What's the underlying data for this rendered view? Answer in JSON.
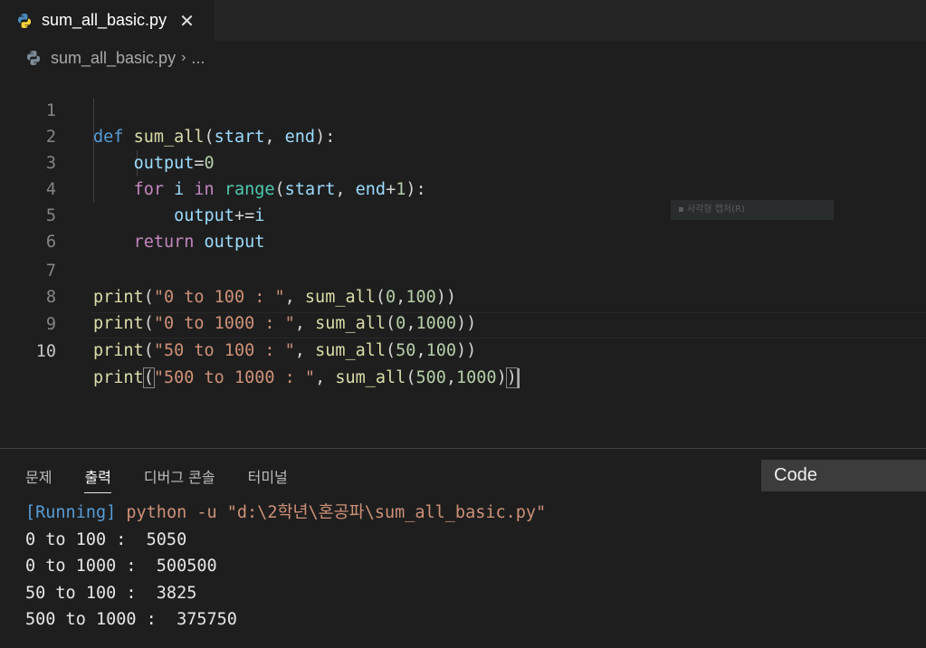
{
  "tab": {
    "file_name": "sum_all_basic.py",
    "close_glyph": "✕"
  },
  "breadcrumb": {
    "file_name": "sum_all_basic.py",
    "separator": "›",
    "more": "..."
  },
  "editor": {
    "line_numbers": [
      "1",
      "2",
      "3",
      "4",
      "5",
      "6",
      "7",
      "8",
      "9",
      "10"
    ],
    "active_line": 10
  },
  "context_hint": "사각형 캡처(R)",
  "panel": {
    "tabs": [
      "문제",
      "출력",
      "디버그 콘솔",
      "터미널"
    ],
    "active_tab": "출력",
    "channel": "Code",
    "output": {
      "running_tag": "[Running]",
      "command": " python -u \"d:\\2학년\\혼공파\\sum_all_basic.py\"",
      "lines": [
        "0 to 100 :  5050",
        "0 to 1000 :  500500",
        "50 to 100 :  3825",
        "500 to 1000 :  375750"
      ]
    }
  },
  "colors": {
    "background": "#1e1e1e",
    "keyword": "#569cd6",
    "control": "#c586c0",
    "function": "#dcdcaa",
    "variable": "#9cdcfe",
    "builtin": "#4ec9b0",
    "number": "#b5cea8",
    "string": "#ce9178"
  }
}
